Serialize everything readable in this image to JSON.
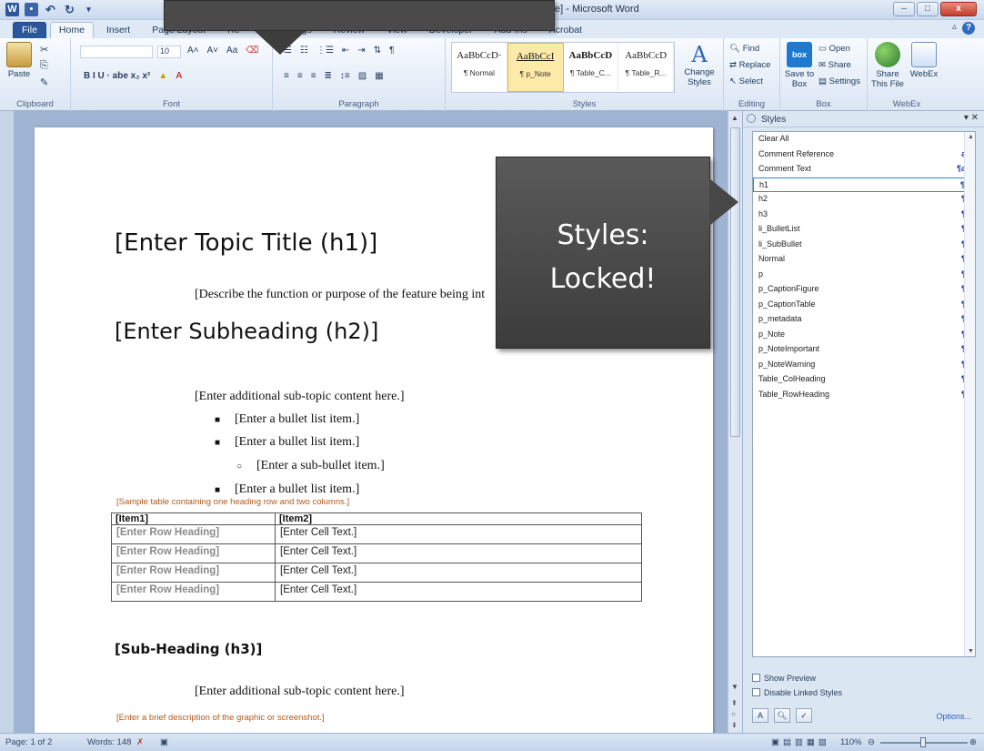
{
  "window": {
    "title": "e] - Microsoft Word",
    "min": "–",
    "max": "□",
    "close": "x"
  },
  "tabs": [
    "File",
    "Home",
    "Insert",
    "Page Layout",
    "Re",
    "gs",
    "Review",
    "View",
    "Developer",
    "Add-Ins",
    "Acrobat"
  ],
  "ribbon": {
    "clipboard": {
      "paste": "Paste",
      "label": "Clipboard"
    },
    "font": {
      "size": "10",
      "label": "Font",
      "row2": "B   I   U  ·  abe   x₂   x²"
    },
    "paragraph": {
      "label": "Paragraph"
    },
    "styles": {
      "label": "Styles",
      "tiles": [
        {
          "sample": "AaBbCcD·",
          "name": "¶ Normal"
        },
        {
          "sample": "AaBbCcI",
          "name": "¶ p_Note"
        },
        {
          "sample": "AaBbCcD",
          "name": "¶ Table_C..."
        },
        {
          "sample": "AaBbCcD",
          "name": "¶ Table_R..."
        }
      ],
      "change": "Change Styles"
    },
    "editing": {
      "find": "Find",
      "replace": "Replace",
      "select": "Select",
      "label": "Editing"
    },
    "box": {
      "logo": "box",
      "save": "Save to Box",
      "open": "Open",
      "share": "Share",
      "settings": "Settings",
      "label": "Box"
    },
    "webex": {
      "share": "Share This File",
      "webex": "WebEx",
      "label": "WebEx"
    }
  },
  "document": {
    "h1": "[Enter Topic Title (h1)]",
    "desc": "[Describe the function or purpose of the feature being int",
    "h2": "[Enter Subheading (h2)]",
    "subtopic": "[Enter additional sub-topic content here.]",
    "bullets": [
      {
        "text": "[Enter a bullet list item.]",
        "level": 1
      },
      {
        "text": "[Enter a bullet list item.]",
        "level": 1
      },
      {
        "text": "[Enter a sub-bullet item.]",
        "level": 2
      },
      {
        "text": "[Enter a bullet list item.]",
        "level": 1
      }
    ],
    "table_caption": "[Sample table containing one heading row and two columns.]",
    "table": {
      "headers": [
        "[Item1]",
        "[Item2]"
      ],
      "rows": [
        [
          "[Enter Row Heading]",
          "[Enter Cell Text.]"
        ],
        [
          "[Enter Row Heading]",
          "[Enter Cell Text.]"
        ],
        [
          "[Enter Row Heading]",
          "[Enter Cell Text.]"
        ],
        [
          "[Enter Row Heading]",
          "[Enter Cell Text.]"
        ]
      ]
    },
    "h3": "[Sub-Heading (h3)]",
    "subtopic2": "[Enter additional sub-topic content here.]",
    "graphic_caption": "[Enter a brief description of the graphic or screenshot.]"
  },
  "styles_pane": {
    "title": "Styles",
    "items": [
      {
        "name": "Clear All",
        "mark": ""
      },
      {
        "name": "Comment Reference",
        "mark": "a"
      },
      {
        "name": "Comment Text",
        "mark": "¶a"
      },
      {
        "name": "h1",
        "mark": "¶"
      },
      {
        "name": "h2",
        "mark": "¶"
      },
      {
        "name": "h3",
        "mark": "¶"
      },
      {
        "name": "li_BulletList",
        "mark": "¶"
      },
      {
        "name": "li_SubBullet",
        "mark": "¶"
      },
      {
        "name": "Normal",
        "mark": "¶"
      },
      {
        "name": "p",
        "mark": "¶"
      },
      {
        "name": "p_CaptionFigure",
        "mark": "¶"
      },
      {
        "name": "p_CaptionTable",
        "mark": "¶"
      },
      {
        "name": "p_metadata",
        "mark": "¶"
      },
      {
        "name": "p_Note",
        "mark": "¶"
      },
      {
        "name": "p_NoteImportant",
        "mark": "¶"
      },
      {
        "name": "p_NoteWarning",
        "mark": "¶"
      },
      {
        "name": "Table_ColHeading",
        "mark": "¶"
      },
      {
        "name": "Table_RowHeading",
        "mark": "¶"
      }
    ],
    "selected": "h1",
    "show_preview": "Show Preview",
    "disable_linked": "Disable Linked Styles",
    "options": "Options..."
  },
  "status": {
    "page": "Page: 1 of 2",
    "words": "Words: 148",
    "zoom": "110%"
  },
  "callout": {
    "line1": "Styles:",
    "line2": "Locked!"
  }
}
